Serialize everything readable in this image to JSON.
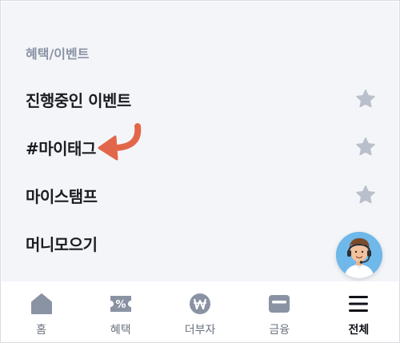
{
  "section": {
    "title": "혜택/이벤트"
  },
  "menu": {
    "items": [
      {
        "label": "진행중인 이벤트",
        "icon": "star-icon",
        "favorited": false
      },
      {
        "label": "#마이태그",
        "icon": "star-icon",
        "favorited": false
      },
      {
        "label": "마이스탬프",
        "icon": "star-icon",
        "favorited": false
      },
      {
        "label": "머니모으기"
      }
    ]
  },
  "annotation": {
    "icon": "curved-arrow-icon",
    "color": "#e2674a"
  },
  "chatbot": {
    "icon": "support-agent-avatar-icon"
  },
  "tabbar": {
    "tabs": [
      {
        "label": "홈",
        "icon": "home-icon",
        "active": false
      },
      {
        "label": "혜택",
        "icon": "coupon-icon",
        "active": false
      },
      {
        "label": "더부자",
        "icon": "won-coin-icon",
        "active": false
      },
      {
        "label": "금융",
        "icon": "card-icon",
        "active": false
      },
      {
        "label": "전체",
        "icon": "menu-icon",
        "active": true
      }
    ]
  },
  "colors": {
    "background": "#f4f5f9",
    "star_inactive": "#b9c0cc",
    "tab_icon_inactive": "#8a93a3",
    "tab_icon_active": "#111318",
    "arrow": "#e2674a"
  }
}
